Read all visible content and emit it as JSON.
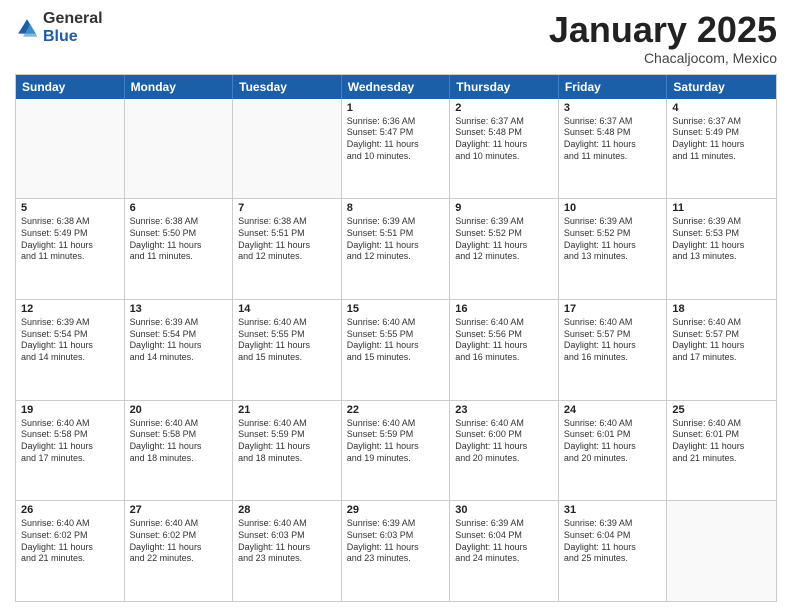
{
  "logo": {
    "general": "General",
    "blue": "Blue"
  },
  "header": {
    "month": "January 2025",
    "location": "Chacaljocom, Mexico"
  },
  "weekdays": [
    "Sunday",
    "Monday",
    "Tuesday",
    "Wednesday",
    "Thursday",
    "Friday",
    "Saturday"
  ],
  "rows": [
    [
      {
        "date": "",
        "info": "",
        "empty": true
      },
      {
        "date": "",
        "info": "",
        "empty": true
      },
      {
        "date": "",
        "info": "",
        "empty": true
      },
      {
        "date": "1",
        "info": "Sunrise: 6:36 AM\nSunset: 5:47 PM\nDaylight: 11 hours\nand 10 minutes.",
        "empty": false
      },
      {
        "date": "2",
        "info": "Sunrise: 6:37 AM\nSunset: 5:48 PM\nDaylight: 11 hours\nand 10 minutes.",
        "empty": false
      },
      {
        "date": "3",
        "info": "Sunrise: 6:37 AM\nSunset: 5:48 PM\nDaylight: 11 hours\nand 11 minutes.",
        "empty": false
      },
      {
        "date": "4",
        "info": "Sunrise: 6:37 AM\nSunset: 5:49 PM\nDaylight: 11 hours\nand 11 minutes.",
        "empty": false
      }
    ],
    [
      {
        "date": "5",
        "info": "Sunrise: 6:38 AM\nSunset: 5:49 PM\nDaylight: 11 hours\nand 11 minutes.",
        "empty": false
      },
      {
        "date": "6",
        "info": "Sunrise: 6:38 AM\nSunset: 5:50 PM\nDaylight: 11 hours\nand 11 minutes.",
        "empty": false
      },
      {
        "date": "7",
        "info": "Sunrise: 6:38 AM\nSunset: 5:51 PM\nDaylight: 11 hours\nand 12 minutes.",
        "empty": false
      },
      {
        "date": "8",
        "info": "Sunrise: 6:39 AM\nSunset: 5:51 PM\nDaylight: 11 hours\nand 12 minutes.",
        "empty": false
      },
      {
        "date": "9",
        "info": "Sunrise: 6:39 AM\nSunset: 5:52 PM\nDaylight: 11 hours\nand 12 minutes.",
        "empty": false
      },
      {
        "date": "10",
        "info": "Sunrise: 6:39 AM\nSunset: 5:52 PM\nDaylight: 11 hours\nand 13 minutes.",
        "empty": false
      },
      {
        "date": "11",
        "info": "Sunrise: 6:39 AM\nSunset: 5:53 PM\nDaylight: 11 hours\nand 13 minutes.",
        "empty": false
      }
    ],
    [
      {
        "date": "12",
        "info": "Sunrise: 6:39 AM\nSunset: 5:54 PM\nDaylight: 11 hours\nand 14 minutes.",
        "empty": false
      },
      {
        "date": "13",
        "info": "Sunrise: 6:39 AM\nSunset: 5:54 PM\nDaylight: 11 hours\nand 14 minutes.",
        "empty": false
      },
      {
        "date": "14",
        "info": "Sunrise: 6:40 AM\nSunset: 5:55 PM\nDaylight: 11 hours\nand 15 minutes.",
        "empty": false
      },
      {
        "date": "15",
        "info": "Sunrise: 6:40 AM\nSunset: 5:55 PM\nDaylight: 11 hours\nand 15 minutes.",
        "empty": false
      },
      {
        "date": "16",
        "info": "Sunrise: 6:40 AM\nSunset: 5:56 PM\nDaylight: 11 hours\nand 16 minutes.",
        "empty": false
      },
      {
        "date": "17",
        "info": "Sunrise: 6:40 AM\nSunset: 5:57 PM\nDaylight: 11 hours\nand 16 minutes.",
        "empty": false
      },
      {
        "date": "18",
        "info": "Sunrise: 6:40 AM\nSunset: 5:57 PM\nDaylight: 11 hours\nand 17 minutes.",
        "empty": false
      }
    ],
    [
      {
        "date": "19",
        "info": "Sunrise: 6:40 AM\nSunset: 5:58 PM\nDaylight: 11 hours\nand 17 minutes.",
        "empty": false
      },
      {
        "date": "20",
        "info": "Sunrise: 6:40 AM\nSunset: 5:58 PM\nDaylight: 11 hours\nand 18 minutes.",
        "empty": false
      },
      {
        "date": "21",
        "info": "Sunrise: 6:40 AM\nSunset: 5:59 PM\nDaylight: 11 hours\nand 18 minutes.",
        "empty": false
      },
      {
        "date": "22",
        "info": "Sunrise: 6:40 AM\nSunset: 5:59 PM\nDaylight: 11 hours\nand 19 minutes.",
        "empty": false
      },
      {
        "date": "23",
        "info": "Sunrise: 6:40 AM\nSunset: 6:00 PM\nDaylight: 11 hours\nand 20 minutes.",
        "empty": false
      },
      {
        "date": "24",
        "info": "Sunrise: 6:40 AM\nSunset: 6:01 PM\nDaylight: 11 hours\nand 20 minutes.",
        "empty": false
      },
      {
        "date": "25",
        "info": "Sunrise: 6:40 AM\nSunset: 6:01 PM\nDaylight: 11 hours\nand 21 minutes.",
        "empty": false
      }
    ],
    [
      {
        "date": "26",
        "info": "Sunrise: 6:40 AM\nSunset: 6:02 PM\nDaylight: 11 hours\nand 21 minutes.",
        "empty": false
      },
      {
        "date": "27",
        "info": "Sunrise: 6:40 AM\nSunset: 6:02 PM\nDaylight: 11 hours\nand 22 minutes.",
        "empty": false
      },
      {
        "date": "28",
        "info": "Sunrise: 6:40 AM\nSunset: 6:03 PM\nDaylight: 11 hours\nand 23 minutes.",
        "empty": false
      },
      {
        "date": "29",
        "info": "Sunrise: 6:39 AM\nSunset: 6:03 PM\nDaylight: 11 hours\nand 23 minutes.",
        "empty": false
      },
      {
        "date": "30",
        "info": "Sunrise: 6:39 AM\nSunset: 6:04 PM\nDaylight: 11 hours\nand 24 minutes.",
        "empty": false
      },
      {
        "date": "31",
        "info": "Sunrise: 6:39 AM\nSunset: 6:04 PM\nDaylight: 11 hours\nand 25 minutes.",
        "empty": false
      },
      {
        "date": "",
        "info": "",
        "empty": true
      }
    ]
  ]
}
